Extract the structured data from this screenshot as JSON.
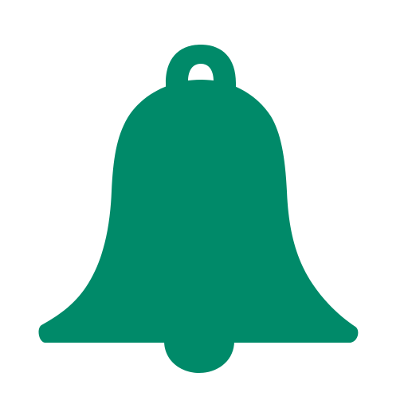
{
  "icon": {
    "name": "bell-icon",
    "fill_color": "#008a69",
    "background_color": "#ffffff"
  }
}
